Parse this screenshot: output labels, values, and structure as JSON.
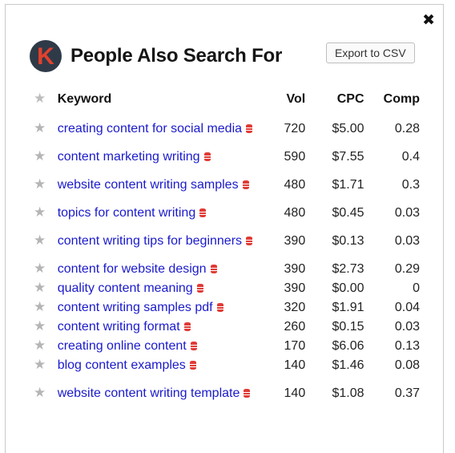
{
  "panel": {
    "logo_letter": "K",
    "title": "People Also Search For",
    "export_label": "Export to CSV",
    "close_glyph": "✖"
  },
  "table": {
    "headers": {
      "keyword": "Keyword",
      "vol": "Vol",
      "cpc": "CPC",
      "comp": "Comp"
    },
    "rows": [
      {
        "keyword": "creating content for social media",
        "vol": "720",
        "cpc": "$5.00",
        "comp": "0.28"
      },
      {
        "keyword": "content marketing writing",
        "vol": "590",
        "cpc": "$7.55",
        "comp": "0.4"
      },
      {
        "keyword": "website content writing samples",
        "vol": "480",
        "cpc": "$1.71",
        "comp": "0.3"
      },
      {
        "keyword": "topics for content writing",
        "vol": "480",
        "cpc": "$0.45",
        "comp": "0.03"
      },
      {
        "keyword": "content writing tips for beginners",
        "vol": "390",
        "cpc": "$0.13",
        "comp": "0.03"
      },
      {
        "keyword": "content for website design",
        "vol": "390",
        "cpc": "$2.73",
        "comp": "0.29"
      },
      {
        "keyword": "quality content meaning",
        "vol": "390",
        "cpc": "$0.00",
        "comp": "0"
      },
      {
        "keyword": "content writing samples pdf",
        "vol": "320",
        "cpc": "$1.91",
        "comp": "0.04"
      },
      {
        "keyword": "content writing format",
        "vol": "260",
        "cpc": "$0.15",
        "comp": "0.03"
      },
      {
        "keyword": "creating online content",
        "vol": "170",
        "cpc": "$6.06",
        "comp": "0.13"
      },
      {
        "keyword": "blog content examples",
        "vol": "140",
        "cpc": "$1.46",
        "comp": "0.08"
      },
      {
        "keyword": "website content writing template",
        "vol": "140",
        "cpc": "$1.08",
        "comp": "0.37"
      }
    ]
  },
  "icons": {
    "close": "close-icon",
    "star": "star-icon",
    "database": "database-icon"
  },
  "colors": {
    "link": "#1a1acc",
    "logo_bg": "#2f3a48",
    "logo_letter": "#e2412d",
    "db_icon": "#e03b36",
    "star": "#b5b5b5"
  }
}
